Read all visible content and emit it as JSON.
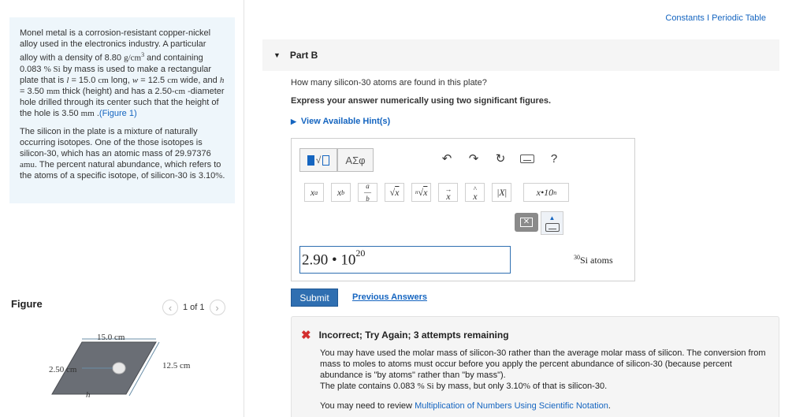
{
  "problem": {
    "p1_a": "Monel metal is a corrosion-resistant copper-nickel alloy used in the electronics industry. A particular alloy with a density of 8.80 ",
    "p1_density_unit": "g/cm",
    "p1_b": " and containing 0.083 ",
    "p1_pct": "% Si",
    "p1_c": " by mass is used to make a rectangular plate that is ",
    "p1_l": "l",
    "p1_d": " = 15.0 ",
    "p1_cm1": "cm",
    "p1_e": " long, ",
    "p1_w": "w",
    "p1_f": " = 12.5 ",
    "p1_cm2": "cm",
    "p1_g": " wide, and ",
    "p1_h": "h",
    "p1_h2": " = 3.50 ",
    "p1_mm1": "mm",
    "p1_i": " thick (height) and has a 2.50-",
    "p1_cm3": "cm",
    "p1_j": " -diameter hole drilled through its center such that the height of the hole is 3.50 ",
    "p1_mm2": "mm",
    "p1_k": " .",
    "figure_link": "(Figure 1)",
    "p2_a": "The silicon in the plate is a mixture of naturally occurring isotopes. One of the those isotopes is silicon-30, which has an atomic mass of 29.97376 ",
    "p2_amu": "amu",
    "p2_b": ". The percent natural abundance, which refers to the atoms of a specific isotope, of silicon-30 is 3.10",
    "p2_pct": "%",
    "p2_c": "."
  },
  "figure": {
    "label": "Figure",
    "pager": "1 of 1",
    "dim_length": "15.0 cm",
    "dim_width": "12.5 cm",
    "dim_hole": "2.50 cm",
    "dim_height": "h"
  },
  "header": {
    "constants": "Constants",
    "separator": "I",
    "periodic": "Periodic Table"
  },
  "part": {
    "title": "Part B",
    "question": "How many silicon-30 atoms are found in this plate?",
    "instruction": "Express your answer numerically using two significant figures.",
    "hints": "View Available Hint(s)"
  },
  "toolbar": {
    "greek": "ΑΣφ",
    "help": "?",
    "sci_notation": "x•10"
  },
  "answer": {
    "mantissa": "2.90",
    "dot": " • 10",
    "exponent": "20",
    "units_sup": "30",
    "units": "Si atoms"
  },
  "actions": {
    "submit": "Submit",
    "previous": "Previous Answers"
  },
  "feedback": {
    "title": "Incorrect; Try Again; 3 attempts remaining",
    "line1": "You may have used the molar mass of silicon-30 rather than the average molar mass of silicon. The conversion from mass to moles to atoms must occur before you apply the percent abundance of silicon-30 (because percent abundance is \"by atoms\" rather than \"by mass\").",
    "line2_a": "The plate contains 0.083 ",
    "line2_pct": "% Si",
    "line2_b": " by mass, but only 3.10",
    "line2_pct2": "%",
    "line2_c": " of that is silicon-30.",
    "review_a": "You may need to review ",
    "review_link": "Multiplication of Numbers Using Scientific Notation",
    "review_b": "."
  },
  "colors": {
    "accent": "#1565c0",
    "problem_bg": "#eef6fb",
    "error": "#d32f2f"
  }
}
